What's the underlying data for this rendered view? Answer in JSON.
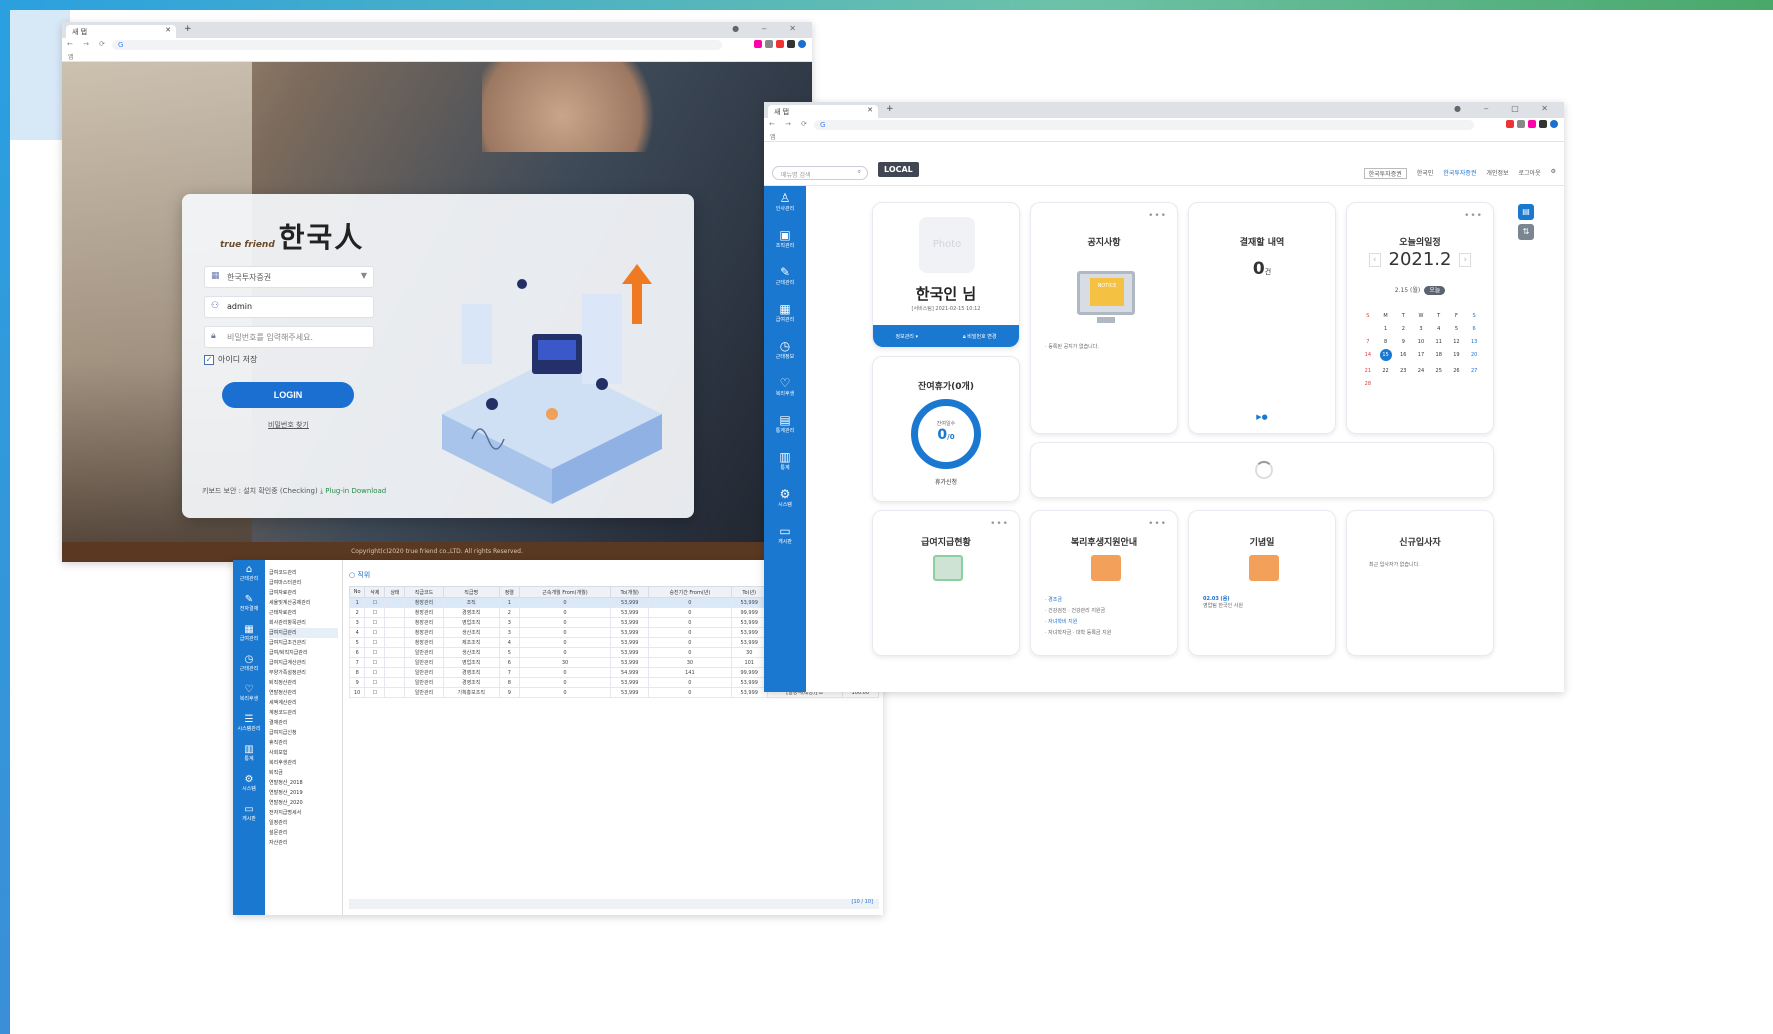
{
  "login_window": {
    "tab_title": "새 탭",
    "omnibox": "G",
    "bookmark_bar": "앱",
    "logo_small": "true friend",
    "logo_big": "한국人",
    "company_select": "한국투자증권",
    "user_id": "admin",
    "password_placeholder": "비밀번호를 입력해주세요.",
    "remember_id": "아이디 저장",
    "login_button": "LOGIN",
    "find_password": "비밀번호 찾기",
    "security_note": "키보드 보안 : 설치 확인중 (Checking)",
    "plugin_download": "Plug-in Download",
    "copyright": "Copyright(c)2020 true friend co.,LTD. All rights Reserved."
  },
  "table_window": {
    "title": "직위",
    "sidebar": [
      "근태관리",
      "전자결재",
      "급여관리",
      "근태관리",
      "복리후생",
      "시스템관리",
      "통계",
      "시스템",
      "게시판"
    ],
    "menu": [
      "급여코드관리",
      "급여마스터관리",
      "급여자료관리",
      "세율및계산공제관리",
      "근태자료관리",
      "회사관리항목관리",
      "급여지급관리",
      "급여지급조건관리",
      "급여/퇴직지급관리",
      "급여지급계산관리",
      "부양가족설정관리",
      "퇴직정산관리",
      "연말정산관리",
      "세액계산관리",
      "계정코드관리",
      "결재관리",
      "급여지급신청",
      "휴직관리",
      "사회보험",
      "복리후생관리",
      "퇴직금",
      "연말정산_2018",
      "연말정산_2019",
      "연말정산_2020",
      "전자지급명세서",
      "일정관리",
      "설문관리",
      "자산관리"
    ],
    "columns": [
      "No",
      "삭제",
      "상태",
      "직급코드",
      "직급명",
      "정렬",
      "근속개월 From(개월)",
      "To(개월)",
      "승진기간 From(년)",
      "To(년)",
      "직급정렬그룹",
      "순"
    ],
    "rows": [
      [
        "1",
        "",
        "",
        "청장관리",
        "조직",
        "1",
        "0",
        "53,999",
        "0",
        "53,999",
        "[일정적(대상)] 조",
        "1"
      ],
      [
        "2",
        "",
        "",
        "청장관리",
        "경영조직",
        "2",
        "0",
        "53,999",
        "0",
        "99,999",
        "[일정적(대상)] 조",
        "1"
      ],
      [
        "3",
        "",
        "",
        "청장관리",
        "영업조직",
        "3",
        "0",
        "53,999",
        "0",
        "53,999",
        "[일정적(대상)] 조",
        "1"
      ],
      [
        "4",
        "",
        "",
        "청장관리",
        "생산조직",
        "3",
        "0",
        "53,999",
        "0",
        "53,999",
        "[일정적(대상)] 조",
        "1"
      ],
      [
        "5",
        "",
        "",
        "청장관리",
        "제조조직",
        "4",
        "0",
        "53,999",
        "0",
        "53,999",
        "[일정적(대상)] 조",
        "1"
      ],
      [
        "6",
        "",
        "",
        "일반관리",
        "생산조직",
        "5",
        "0",
        "53,999",
        "0",
        "30",
        "동산관리",
        "1"
      ],
      [
        "7",
        "",
        "",
        "일반관리",
        "영업조직",
        "6",
        "30",
        "53,999",
        "30",
        "101",
        "동산관리",
        "1"
      ],
      [
        "8",
        "",
        "",
        "일반관리",
        "경영조직",
        "7",
        "0",
        "54,999",
        "141",
        "99,999",
        "동산관리",
        "100.00"
      ],
      [
        "9",
        "",
        "",
        "일반관리",
        "경영조직",
        "8",
        "0",
        "53,999",
        "0",
        "53,999",
        "[일정적(대상)] 조",
        "100.00"
      ],
      [
        "10",
        "",
        "",
        "일반관리",
        "기획홍보조직",
        "9",
        "0",
        "53,999",
        "0",
        "53,999",
        "[일정적(대상)] 조",
        "100.00"
      ]
    ],
    "footer": "[10 / 10]"
  },
  "dashboard_window": {
    "tab_title": "새 탭",
    "omnibox": "G",
    "bookmark_bar": "앱",
    "search_placeholder": "메뉴명 검색",
    "local_badge": "LOCAL",
    "top_select": "한국투자증권",
    "top_user": "한국인",
    "top_links": [
      "한국투자증권",
      "개인정보",
      "로그아웃"
    ],
    "sidebar": [
      "인사관리",
      "조직관리",
      "근태관리",
      "급여관리",
      "근태정보",
      "복리후생",
      "통계관리",
      "통계",
      "시스템",
      "게시판"
    ],
    "profile": {
      "photo": "Photo",
      "name": "한국인 님",
      "sub": "[서비스팀] 2021-02-15 10:12",
      "bar_left": "정보관리 ▾",
      "bar_right": "비밀번호 변경"
    },
    "notice": {
      "title": "공지사항",
      "paper": "NOTICE",
      "empty": "등록된 공지가 없습니다."
    },
    "approval": {
      "title": "결재할 내역",
      "count": "0",
      "unit": "건",
      "pager": "▶●"
    },
    "calendar": {
      "title": "오늘의일정",
      "year_month": "2021.2",
      "today_label": "2.15 (월)",
      "today_pill": "오늘",
      "days": [
        "S",
        "M",
        "T",
        "W",
        "T",
        "F",
        "S"
      ],
      "dates": [
        "",
        "1",
        "2",
        "3",
        "4",
        "5",
        "6",
        "7",
        "8",
        "9",
        "10",
        "11",
        "12",
        "13",
        "14",
        "15",
        "16",
        "17",
        "18",
        "19",
        "20",
        "21",
        "22",
        "23",
        "24",
        "25",
        "26",
        "27",
        "28",
        "",
        "",
        "",
        "",
        "",
        ""
      ],
      "today": "15"
    },
    "leave": {
      "title": "잔여휴가(0개)",
      "ring_label": "잔여일수",
      "ring_value": "0",
      "ring_unit": "/0",
      "link": "휴가신청"
    },
    "payroll": {
      "title": "급여지급현황"
    },
    "welfare": {
      "title": "복리후생지원안내",
      "items": [
        "· 경조금",
        "· 건강검진 · 건강관리 지원금",
        "· 자녀학비 지원",
        "· 자녀학자금 · 대학 등록금 지원"
      ]
    },
    "birthday": {
      "title": "기념일",
      "date": "02.03",
      "type": "(음)",
      "name": "영업팀 한국인 사원"
    },
    "newhire": {
      "title": "신규입사자",
      "empty": "최근 입사자가 없습니다."
    }
  }
}
